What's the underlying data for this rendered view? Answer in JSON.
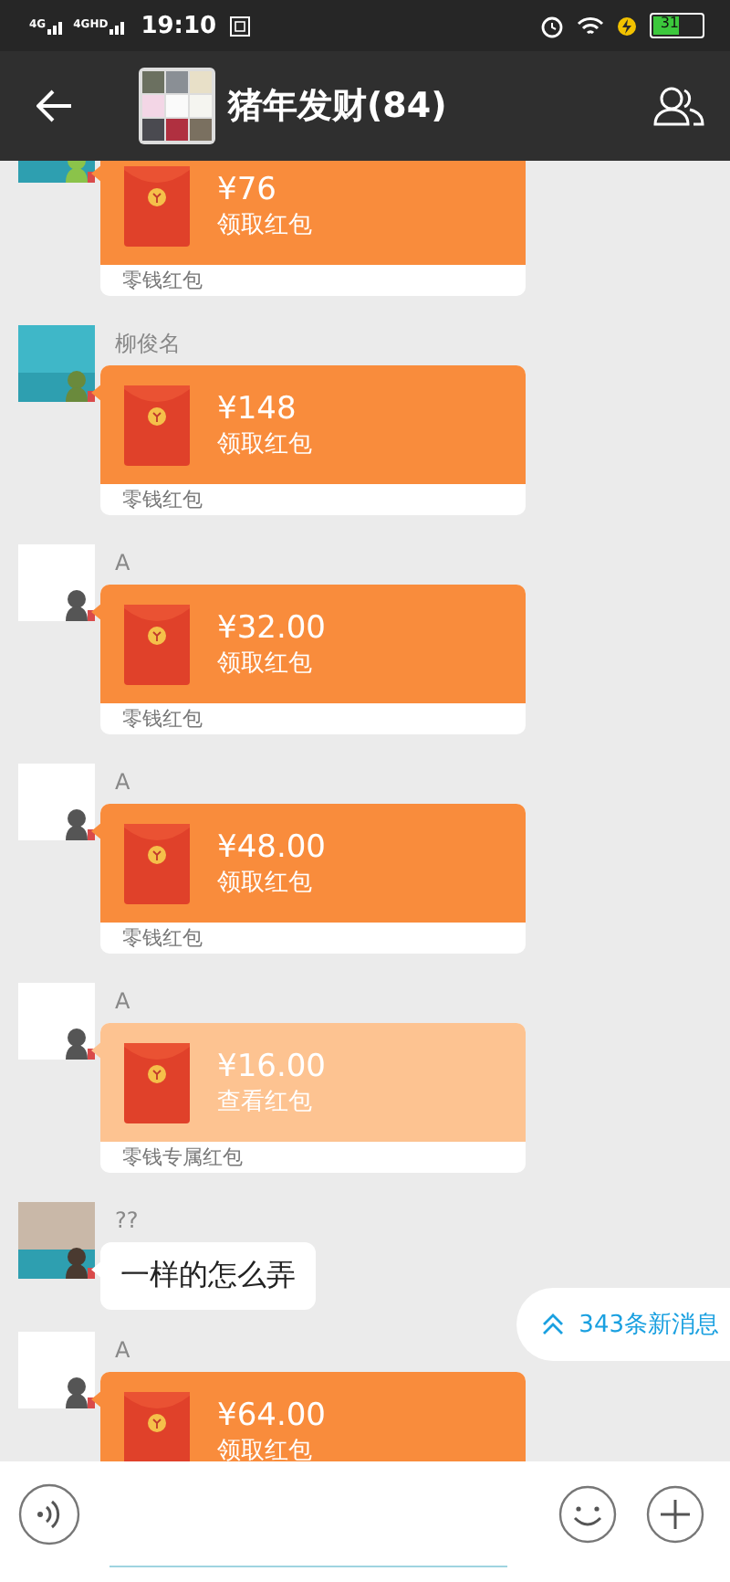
{
  "status_bar": {
    "network": [
      "4G",
      "4GHD"
    ],
    "time": "19:10",
    "battery": "31"
  },
  "header": {
    "title": "猪年发财(84)"
  },
  "messages": [
    {
      "kind": "red_packet",
      "amount": "¥76",
      "action": "领取红包",
      "footer": "零钱红包",
      "opened": false
    },
    {
      "kind": "red_packet",
      "sender": "柳俊名",
      "amount": "¥148",
      "action": "领取红包",
      "footer": "零钱红包",
      "opened": false
    },
    {
      "kind": "red_packet",
      "sender": "A",
      "amount": "¥32.00",
      "action": "领取红包",
      "footer": "零钱红包",
      "opened": false
    },
    {
      "kind": "red_packet",
      "sender": "A",
      "amount": "¥48.00",
      "action": "领取红包",
      "footer": "零钱红包",
      "opened": false
    },
    {
      "kind": "red_packet",
      "sender": "A",
      "amount": "¥16.00",
      "action": "查看红包",
      "footer": "零钱专属红包",
      "opened": true
    },
    {
      "kind": "text",
      "sender": "??",
      "text": "一样的怎么弄"
    },
    {
      "kind": "red_packet",
      "sender": "A",
      "amount": "¥64.00",
      "action": "领取红包",
      "opened": false
    }
  ],
  "new_messages": "343条新消息"
}
